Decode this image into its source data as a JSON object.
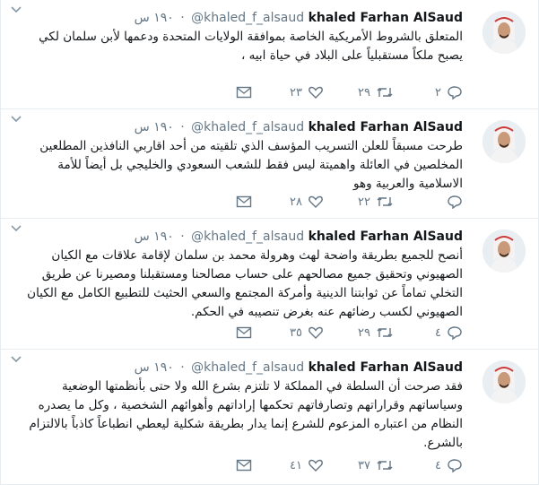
{
  "tweets": [
    {
      "author_name": "khaled Farhan AlSaud",
      "author_handle": "@khaled_f_alsaud",
      "separator": "·",
      "time": "١٩٠ س",
      "text": "المتعلق بالشروط الأمريكية الخاصة بموافقة الولايات المتحدة ودعمها لأبن سلمان لكي يصبح ملكاً مستقبلياً على البلاد في حياة ابيه ،",
      "replies": "٢",
      "retweets": "٢٩",
      "likes": "٢٣"
    },
    {
      "author_name": "khaled Farhan AlSaud",
      "author_handle": "@khaled_f_alsaud",
      "separator": "·",
      "time": "١٩٠ س",
      "text": "طرحت مسبقاً للعلن التسريب المؤسف الذي تلقيته من أحد اقاربي النافذين المطلعين المخلصين في العائلة واهميتة ليس فقط للشعب السعودي والخليجي بل أيضاً للأمة الاسلامية والعربية وهو",
      "replies": "",
      "retweets": "٢٢",
      "likes": "٢٨"
    },
    {
      "author_name": "khaled Farhan AlSaud",
      "author_handle": "@khaled_f_alsaud",
      "separator": "·",
      "time": "١٩٠ س",
      "text": "أنصح للجميع بطريقة واضحة لهث وهرولة محمد بن سلمان لإقامة علاقات مع الكيان الصهيوني وتحقيق جميع مصالحهم على حساب مصالحنا ومستقبلنا ومصيرنا عن طريق التخلي تماماً عن ثوابتنا الدينية وأمركة المجتمع والسعي الحثيث للتطبيع الكامل مع الكيان الصهيوني لكسب رضائهم عنه بغرض تنصيبه في الحكم.",
      "replies": "٤",
      "retweets": "٢٩",
      "likes": "٣٥"
    },
    {
      "author_name": "khaled Farhan AlSaud",
      "author_handle": "@khaled_f_alsaud",
      "separator": "·",
      "time": "١٩٠ س",
      "text": "فقد صرحت أن السلطة في المملكة لا تلتزم بشرع الله ولا حتى بأنظمتها الوضعية وسياساتهم وقراراتهم وتصارفاتهم تحكمها إراداتهم وأهوائهم الشخصية ، وكل ما يصدره النظام من اعتباره المزعوم للشرع إنما يدار بطريقة شكلية ليعطي انطباعاً كاذباً بالالتزام بالشرع.",
      "replies": "٤",
      "retweets": "٣٧",
      "likes": "٤١"
    }
  ],
  "icons": {
    "caret": "chevron-down-icon",
    "reply": "reply-icon",
    "retweet": "retweet-icon",
    "like": "heart-icon",
    "dm": "envelope-icon"
  },
  "colors": {
    "name": "#14171a",
    "secondary": "#657786",
    "divider": "#e6ecf0"
  }
}
